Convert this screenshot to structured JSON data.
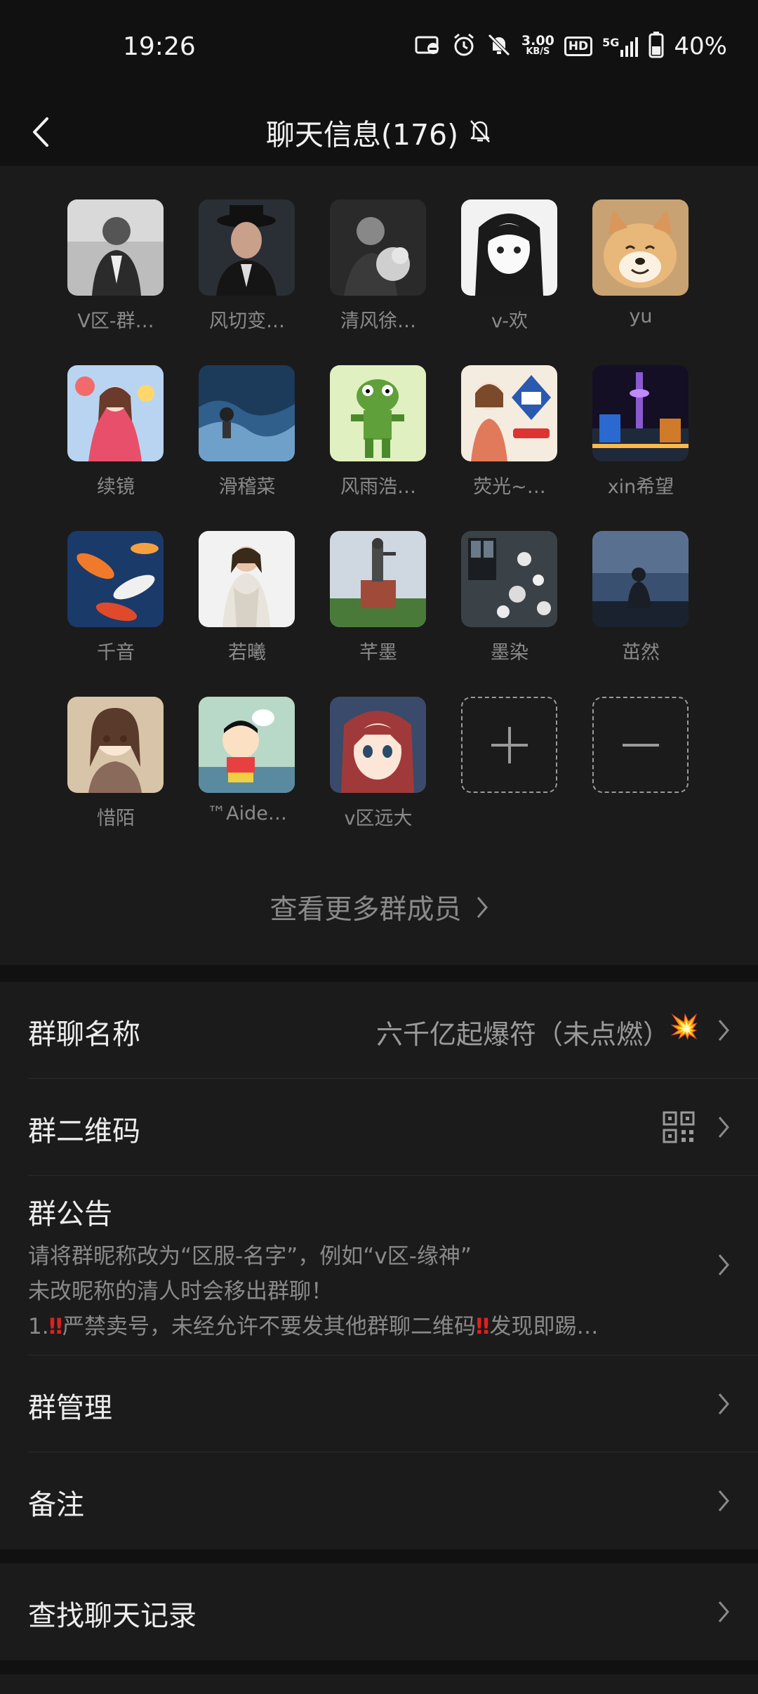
{
  "status_bar": {
    "time": "19:26",
    "speed_value": "3.00",
    "speed_unit": "KB/S",
    "hd": "HD",
    "network": "5G",
    "battery": "40%"
  },
  "header": {
    "title": "聊天信息(176)"
  },
  "members": [
    {
      "name": "V区-群…"
    },
    {
      "name": "风切变…"
    },
    {
      "name": "清风徐…"
    },
    {
      "name": "v-欢"
    },
    {
      "name": "yu"
    },
    {
      "name": "续镜"
    },
    {
      "name": "滑稽菜"
    },
    {
      "name": "风雨浩…"
    },
    {
      "name": "荧光~…"
    },
    {
      "name": "xin希望"
    },
    {
      "name": "千音"
    },
    {
      "name": "若曦"
    },
    {
      "name": "芊墨"
    },
    {
      "name": "墨染"
    },
    {
      "name": "茁然"
    },
    {
      "name": "惜陌"
    },
    {
      "name": "™Aide…"
    },
    {
      "name": "v区远大"
    }
  ],
  "view_more": "查看更多群成员",
  "settings": {
    "group_name_label": "群聊名称",
    "group_name_value": "六千亿起爆符（未点燃）",
    "group_name_emoji": "💥",
    "qr_label": "群二维码",
    "notice_label": "群公告",
    "notice_line1": "请将群昵称改为“区服-名字”，例如“v区-缘神”",
    "notice_line2": "未改昵称的清人时会移出群聊！",
    "notice_line3_a": "1.",
    "notice_line3_mark1": "‼",
    "notice_line3_b": "严禁卖号，未经允许不要发其他群聊二维码",
    "notice_line3_mark2": "‼",
    "notice_line3_c": "发现即踢…",
    "manage_label": "群管理",
    "remark_label": "备注",
    "search_label": "查找聊天记录"
  },
  "colors": {
    "background": "#111111",
    "panel": "#1b1b1b",
    "primary_text": "#ededed",
    "secondary_text": "#8a8a8a",
    "warning_red": "#e02020"
  }
}
